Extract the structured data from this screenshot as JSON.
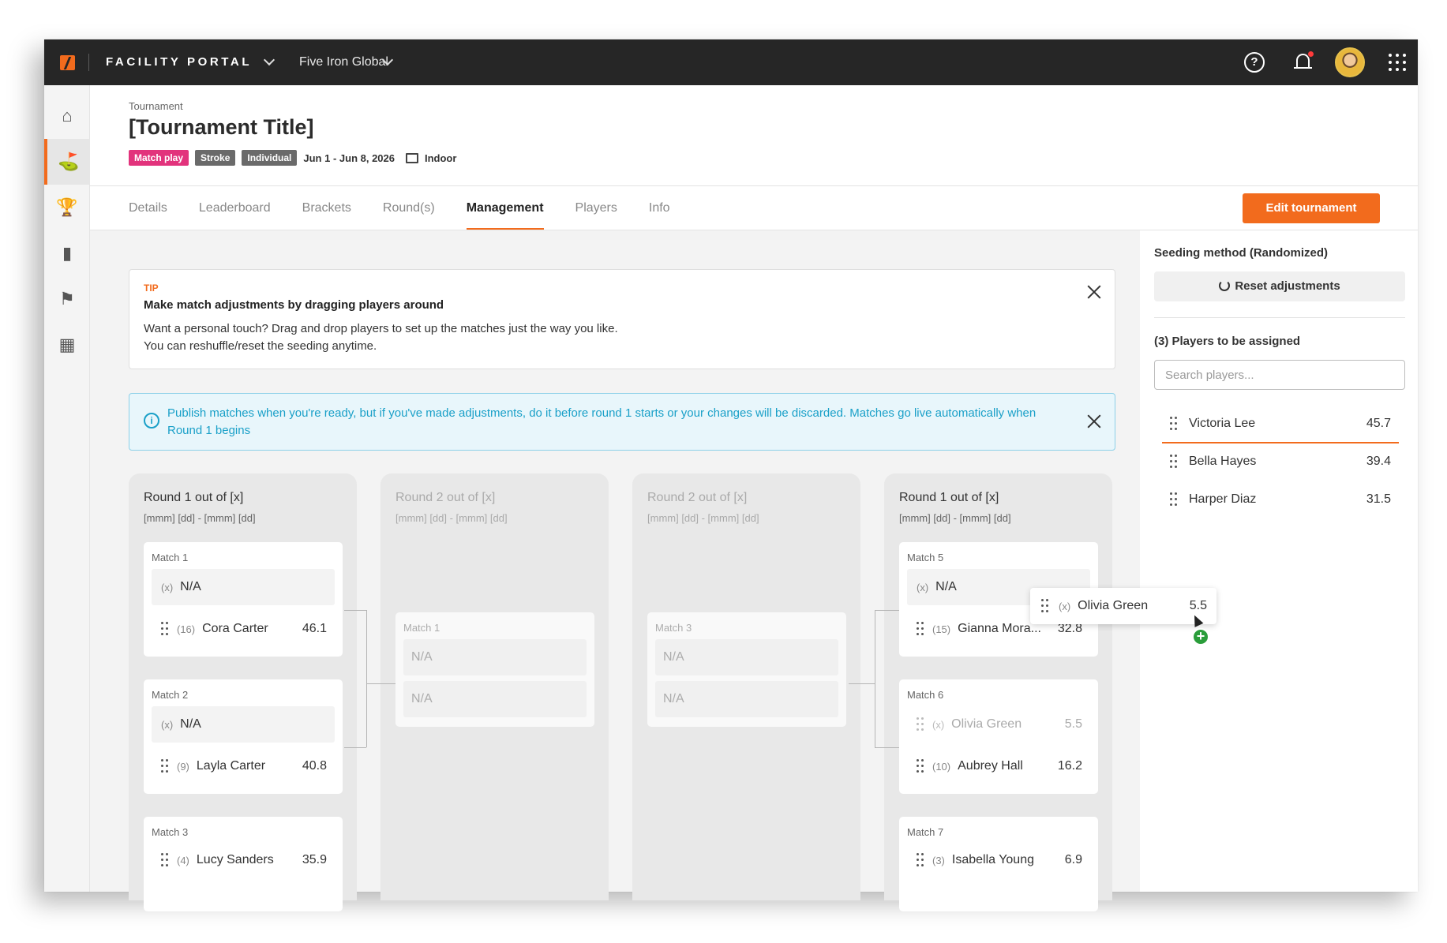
{
  "topbar": {
    "portal_name": "FACILITY PORTAL",
    "org_name": "Five Iron Global",
    "help_icon": "?"
  },
  "sidebar": {
    "items": [
      {
        "icon": "home-icon",
        "glyph": "⌂"
      },
      {
        "icon": "golf-icon",
        "glyph": "⛳"
      },
      {
        "icon": "trophy-icon",
        "glyph": "🏆"
      },
      {
        "icon": "chart-icon",
        "glyph": "▮"
      },
      {
        "icon": "facility-icon",
        "glyph": "⚑"
      },
      {
        "icon": "calendar-icon",
        "glyph": "▦"
      }
    ]
  },
  "header": {
    "breadcrumb": "Tournament",
    "title": "[Tournament Title]",
    "tags": [
      "Match play",
      "Stroke",
      "Individual"
    ],
    "dates": "Jun 1 - Jun 8, 2026",
    "location": "Indoor"
  },
  "tabs": [
    "Details",
    "Leaderboard",
    "Brackets",
    "Round(s)",
    "Management",
    "Players",
    "Info"
  ],
  "active_tab": "Management",
  "edit_button": "Edit tournament",
  "tip": {
    "label": "TIP",
    "heading": "Make match adjustments by dragging players around",
    "line1": "Want a personal touch? Drag and drop players to set up the matches just the way you like.",
    "line2": "You can reshuffle/reset the seeding anytime."
  },
  "info_banner": {
    "icon": "i",
    "text": "Publish matches when you're ready, but if you've made adjustments, do it before round 1 starts or your changes will be discarded. Matches go live automatically when Round 1 begins"
  },
  "columns": [
    {
      "title": "Round 1 out of [x]",
      "dates": "[mmm] [dd] - [mmm] [dd]",
      "matches": [
        {
          "label": "Match 1",
          "slots": [
            {
              "seed": "(x)",
              "name": "N/A"
            },
            {
              "seed": "(16)",
              "name": "Cora Carter",
              "score": "46.1"
            }
          ]
        },
        {
          "label": "Match 2",
          "slots": [
            {
              "seed": "(x)",
              "name": "N/A"
            },
            {
              "seed": "(9)",
              "name": "Layla Carter",
              "score": "40.8"
            }
          ]
        },
        {
          "label": "Match 3",
          "slots": [
            {
              "seed": "(4)",
              "name": "Lucy Sanders",
              "score": "35.9"
            }
          ]
        }
      ]
    },
    {
      "title": "Round 2 out of [x]",
      "dates": "[mmm] [dd] - [mmm] [dd]",
      "matches": [
        {
          "label": "Match 1",
          "slots": [
            {
              "name": "N/A"
            },
            {
              "name": "N/A"
            }
          ]
        }
      ]
    },
    {
      "title": "Round 2 out of [x]",
      "dates": "[mmm] [dd] - [mmm] [dd]",
      "matches": [
        {
          "label": "Match 3",
          "slots": [
            {
              "name": "N/A"
            },
            {
              "name": "N/A"
            }
          ]
        }
      ]
    },
    {
      "title": "Round 1 out of [x]",
      "dates": "[mmm] [dd] - [mmm] [dd]",
      "matches": [
        {
          "label": "Match 5",
          "slots": [
            {
              "seed": "(x)",
              "name": "N/A"
            },
            {
              "seed": "(15)",
              "name": "Gianna Mora...",
              "score": "32.8"
            }
          ]
        },
        {
          "label": "Match 6",
          "slots": [
            {
              "seed": "(x)",
              "name": "Olivia Green",
              "score": "5.5"
            },
            {
              "seed": "(10)",
              "name": "Aubrey Hall",
              "score": "16.2"
            }
          ]
        },
        {
          "label": "Match 7",
          "slots": [
            {
              "seed": "(3)",
              "name": "Isabella Young",
              "score": "6.9"
            }
          ]
        }
      ]
    }
  ],
  "right_panel": {
    "seeding_title": "Seeding method (Randomized)",
    "reset_label": "Reset adjustments",
    "unassigned_title": "(3) Players to be assigned",
    "search_placeholder": "Search players...",
    "players": [
      {
        "name": "Victoria Lee",
        "score": "45.7"
      },
      {
        "name": "Bella Hayes",
        "score": "39.4"
      },
      {
        "name": "Harper Diaz",
        "score": "31.5"
      }
    ]
  },
  "drag_ghost": {
    "seed": "(x)",
    "name": "Olivia Green",
    "score": "5.5",
    "plus": "+"
  },
  "colors": {
    "accent": "#f26b1d",
    "tag_pink": "#e2337c",
    "info_blue": "#1aa0c8",
    "topbar": "#262626"
  }
}
